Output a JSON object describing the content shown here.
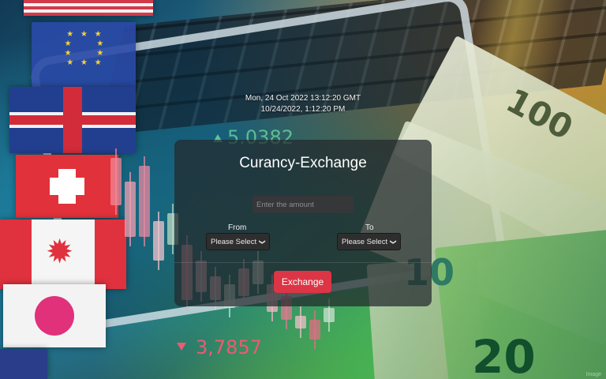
{
  "clock": {
    "utc": "Mon, 24 Oct 2022 13:12:20 GMT",
    "local": "10/24/2022, 1:12:20 PM"
  },
  "form": {
    "title": "Curancy-Exchange",
    "amount_placeholder": "Enter the amount",
    "from_label": "From",
    "to_label": "To",
    "from_select": "Please Select",
    "to_select": "Please Select",
    "submit_label": "Exchange"
  },
  "background": {
    "chart_upper_value": "5.0382",
    "chart_lower_value": "3,7857",
    "bill_values": [
      "100",
      "10",
      "20"
    ],
    "watermark": "Image"
  },
  "colors": {
    "accent": "#dc3545",
    "panel": "#23282d"
  },
  "icons": {
    "select_chevron": "chevron-down-icon"
  }
}
